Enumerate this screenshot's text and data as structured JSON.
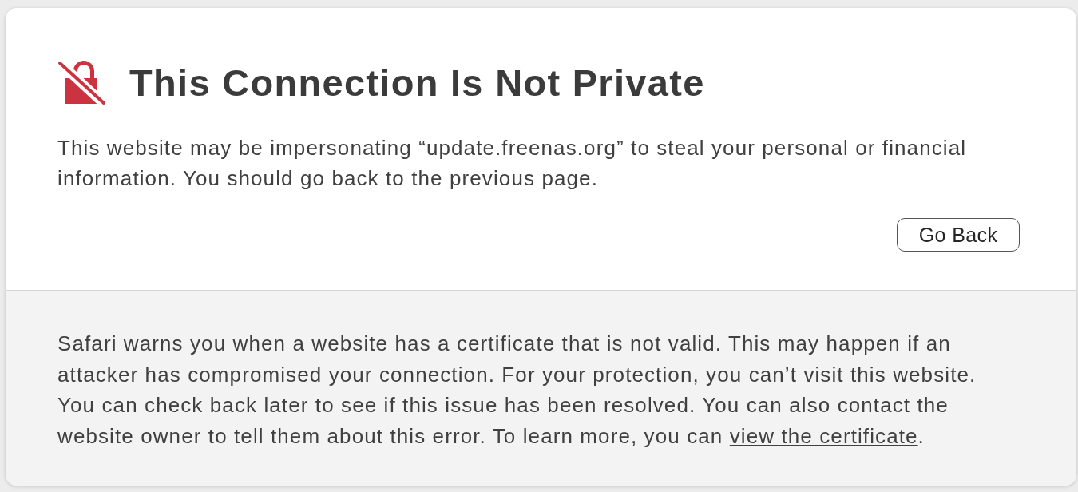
{
  "warning": {
    "title": "This Connection Is Not Private",
    "message": "This website may be impersonating “update.freenas.org” to steal your personal or financial information. You should go back to the previous page.",
    "buttons": [
      {
        "label": "Go Back"
      }
    ]
  },
  "details": {
    "text": "Safari warns you when a website has a certificate that is not valid. This may happen if an attacker has compromised your connection. For your protection, you can’t visit this website. You can check back later to see if this issue has been resolved. You can also contact the website owner to tell them about this error. To learn more, you can",
    "link": "view the certificate",
    "after": "."
  }
}
